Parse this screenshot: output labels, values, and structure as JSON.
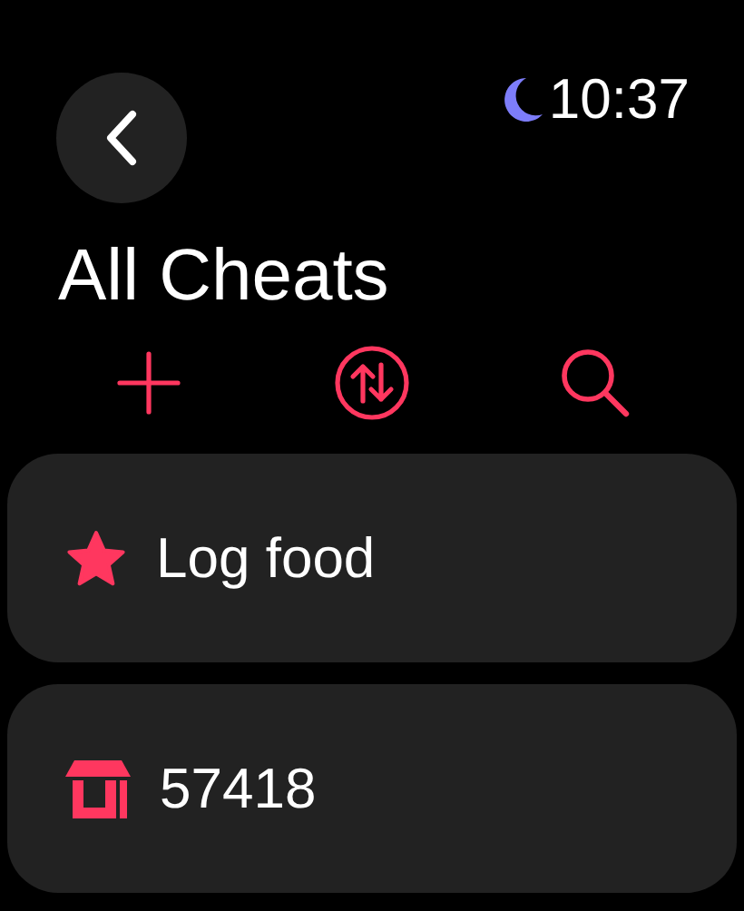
{
  "status_bar": {
    "focus_mode": true,
    "time": "10:37"
  },
  "title": "All Cheats",
  "toolbar": [
    {
      "kind": "add"
    },
    {
      "kind": "sort"
    },
    {
      "kind": "search"
    }
  ],
  "items": [
    {
      "kind": "star",
      "label": "Log food"
    },
    {
      "kind": "store",
      "label": "57418"
    }
  ]
}
